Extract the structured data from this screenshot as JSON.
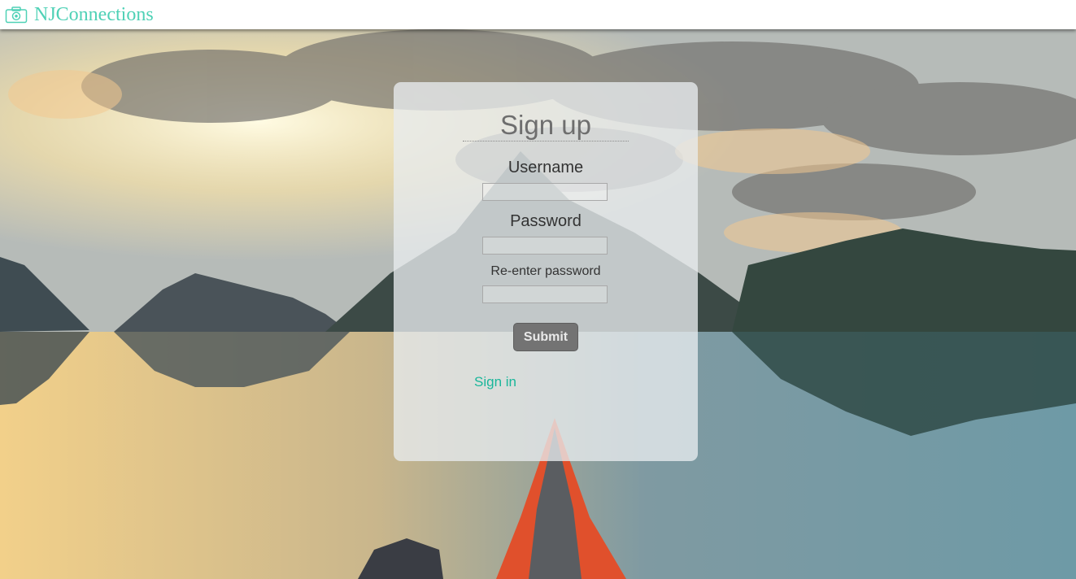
{
  "navbar": {
    "brand": "NJConnections",
    "icon": "camera-icon",
    "brand_color": "#4fd1b6"
  },
  "background": {
    "description_icon": "landscape-photo"
  },
  "signup": {
    "title": "Sign up",
    "username_label": "Username",
    "username_value": "",
    "password_label": "Password",
    "password_value": "",
    "reenter_label": "Re-enter password",
    "reenter_value": "",
    "submit_label": "Submit",
    "signin_link": "Sign in",
    "link_color": "#19b69a",
    "button_color": "#737373"
  }
}
